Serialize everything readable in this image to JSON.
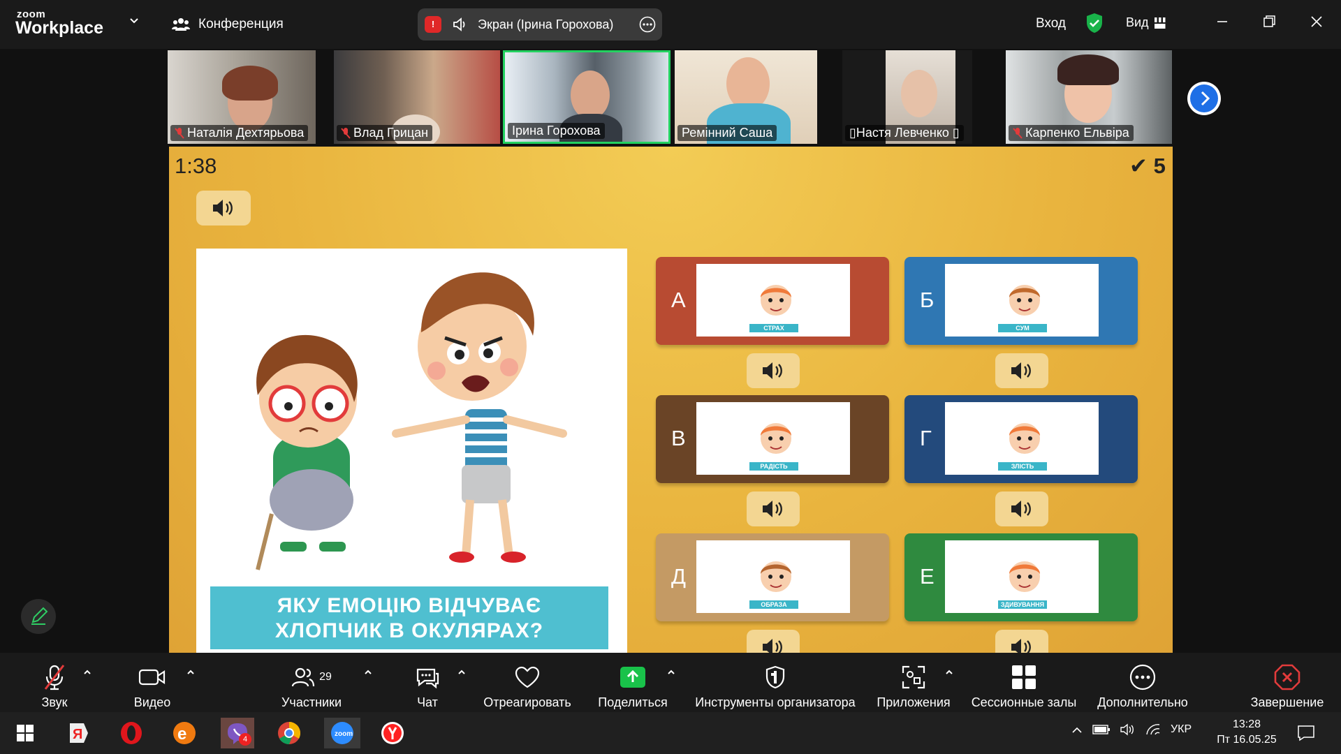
{
  "app": {
    "logo_line1": "zoom",
    "logo_line2": "Workplace"
  },
  "topbar": {
    "conference_label": "Конференция",
    "share_label": "Экран (Ірина Горохова)",
    "rec_badge": "!",
    "login_label": "Вход",
    "view_label": "Вид"
  },
  "participants": [
    {
      "name": "Наталія Дехтярьова",
      "muted": true
    },
    {
      "name": "Влад Грицан",
      "muted": true
    },
    {
      "name": "Ірина Горохова",
      "muted": false
    },
    {
      "name": "Ремінний Саша",
      "muted": false
    },
    {
      "name": "▯Настя Левченко ▯",
      "muted": false
    },
    {
      "name": "Карпенко Ельвіра",
      "muted": true
    }
  ],
  "quiz": {
    "timer": "1:38",
    "score": "✔ 5",
    "question": [
      "ЯКУ ЕМОЦІЮ ВІДЧУВАЄ",
      "ХЛОПЧИК В ОКУЛЯРАХ?"
    ],
    "answers": [
      {
        "letter": "А",
        "tag": "СТРАХ",
        "color": "#b84b32"
      },
      {
        "letter": "Б",
        "tag": "СУМ",
        "color": "#2f77b3"
      },
      {
        "letter": "В",
        "tag": "РАДІСТЬ",
        "color": "#6a4426"
      },
      {
        "letter": "Г",
        "tag": "ЗЛІСТЬ",
        "color": "#234a7c"
      },
      {
        "letter": "Д",
        "tag": "ОБРАЗА",
        "color": "#c49a64"
      },
      {
        "letter": "Е",
        "tag": "ЗДИВУВАННЯ",
        "color": "#2f8a3f"
      }
    ]
  },
  "toolbar": {
    "audio": "Звук",
    "video": "Видео",
    "participants": "Участники",
    "participants_count": "29",
    "chat": "Чат",
    "react": "Отреагировать",
    "share": "Поделиться",
    "host_tools": "Инструменты организатора",
    "apps": "Приложения",
    "breakout": "Сессионные залы",
    "more": "Дополнительно",
    "end": "Завершение"
  },
  "taskbar": {
    "viber_badge": "4",
    "lang": "УКР",
    "time": "13:28",
    "date": "Пт 16.05.25"
  }
}
